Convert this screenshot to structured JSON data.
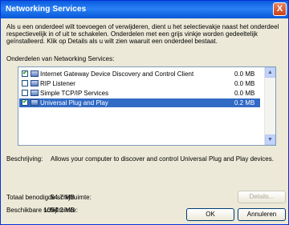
{
  "window": {
    "title": "Networking Services",
    "close_symbol": "X"
  },
  "intro_text": "Als u een onderdeel wilt toevoegen of verwijderen, dient u het selectievakje naast het onderdeel respectievelijk in of uit te schakelen. Onderdelen met een grijs vinkje worden gedeeltelijk geïnstalleerd. Klik op Details als u wilt zien waaruit een onderdeel bestaat.",
  "subcomponents_label": "Onderdelen van Networking Services:",
  "components": [
    {
      "name": "Internet Gateway Device Discovery and Control Client",
      "size": "0.0 MB",
      "checked": true,
      "selected": false
    },
    {
      "name": "RIP Listener",
      "size": "0.0 MB",
      "checked": false,
      "selected": false
    },
    {
      "name": "Simple TCP/IP Services",
      "size": "0.0 MB",
      "checked": false,
      "selected": false
    },
    {
      "name": "Universal Plug and Play",
      "size": "0.2 MB",
      "checked": true,
      "selected": true
    }
  ],
  "description": {
    "label": "Beschrijving:",
    "text": "Allows your computer to discover and control Universal Plug and Play devices."
  },
  "space_required": {
    "label": "Totaal benodigde schijfruimte:",
    "value": "54.7 MB"
  },
  "space_available": {
    "label": "Beschikbare schijfruimte:",
    "value": "1094.2 MB"
  },
  "buttons": {
    "details": "Details...",
    "ok": "OK",
    "cancel": "Annuleren"
  }
}
